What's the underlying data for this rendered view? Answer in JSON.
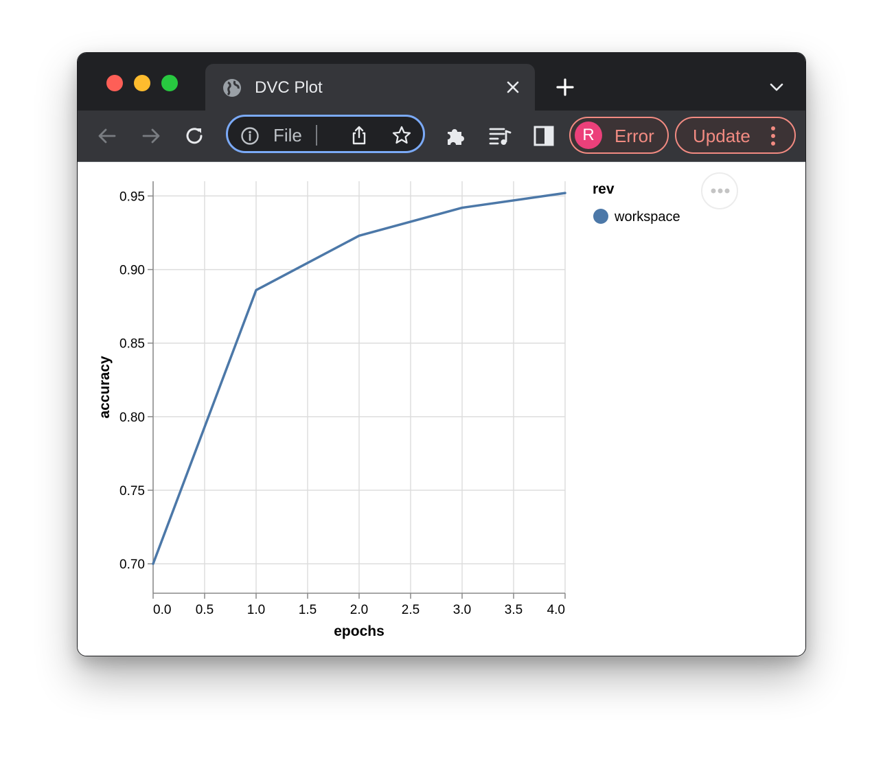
{
  "window": {
    "tab": {
      "title": "DVC Plot",
      "icon": "globe-icon"
    },
    "traffic_colors": {
      "close": "#fe5f57",
      "minimize": "#febc2e",
      "zoom": "#28c840"
    }
  },
  "toolbar": {
    "omnibox_text": "File",
    "profile": {
      "initial": "R",
      "label": "Error",
      "color": "#ec407a"
    },
    "update_label": "Update",
    "accent": "#f28b82"
  },
  "chart_data": {
    "type": "line",
    "xlabel": "epochs",
    "ylabel": "accuracy",
    "xlim": [
      0,
      4
    ],
    "ylim": [
      0.68,
      0.96
    ],
    "xticks": [
      "0.0",
      "0.5",
      "1.0",
      "1.5",
      "2.0",
      "2.5",
      "3.0",
      "3.5",
      "4.0"
    ],
    "yticks": [
      "0.70",
      "0.75",
      "0.80",
      "0.85",
      "0.90",
      "0.95"
    ],
    "grid": true,
    "legend": {
      "title": "rev",
      "position": "top-right"
    },
    "series": [
      {
        "name": "workspace",
        "color": "#4c78a8",
        "x": [
          0,
          1,
          2,
          3,
          4
        ],
        "y": [
          0.7,
          0.886,
          0.923,
          0.942,
          0.952
        ]
      }
    ]
  }
}
